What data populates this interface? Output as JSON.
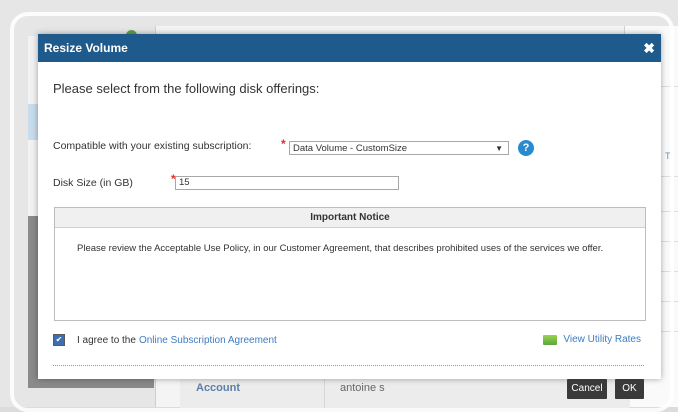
{
  "dialog": {
    "title": "Resize Volume",
    "close_glyph": "✖",
    "heading": "Please select from the following disk offerings:",
    "subscription_label": "Compatible with your existing subscription:",
    "subscription_value": "Data Volume - CustomSize",
    "help_glyph": "?",
    "disk_size_label": "Disk Size (in GB)",
    "disk_size_value": "15",
    "notice_title": "Important Notice",
    "notice_text": "Please review the Acceptable Use Policy, in our Customer Agreement, that describes prohibited uses of the services we offer.",
    "agree_checked": true,
    "agree_text": "I agree to the",
    "agree_link": "Online Subscription Agreement",
    "rates_link": "View Utility Rates",
    "cancel_label": "Cancel",
    "ok_label": "OK"
  },
  "background": {
    "account_label": "Account",
    "account_value": "antoine s",
    "right_fragment": "T"
  },
  "colors": {
    "titlebar": "#1f5a8c",
    "link": "#3d7cc0",
    "required": "#e0302a",
    "button": "#3a3a3a"
  }
}
